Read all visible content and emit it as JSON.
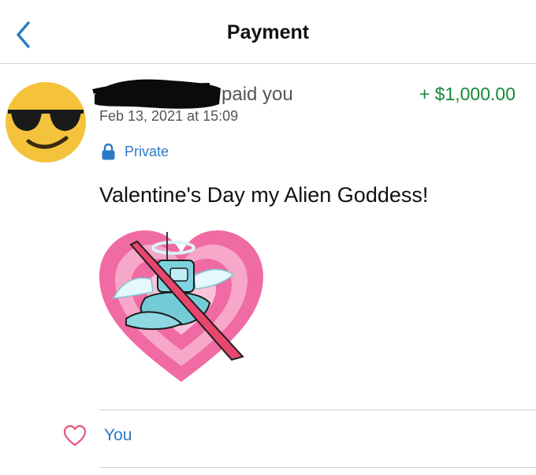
{
  "header": {
    "title": "Payment",
    "back_icon": "chevron-left-icon"
  },
  "transaction": {
    "payer_name": "",
    "action_text": "paid you",
    "amount": "+ $1,000.00",
    "timestamp": "Feb 13, 2021 at 15:09",
    "privacy": "Private",
    "note": "Valentine's Day my Alien Goddess!"
  },
  "likes": {
    "label": "You",
    "icon": "heart-outline-icon"
  },
  "colors": {
    "accent_blue": "#2d79c7",
    "amount_green": "#138a36",
    "heart_pink": "#e8577c"
  }
}
